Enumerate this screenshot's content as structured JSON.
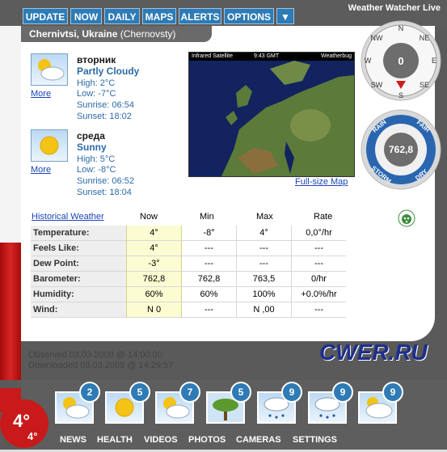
{
  "app_title": "Weather Watcher Live",
  "toolbar": {
    "buttons": [
      "UPDATE",
      "NOW",
      "DAILY",
      "MAPS",
      "ALERTS",
      "OPTIONS"
    ],
    "dropdown_icon": "chevron-down-icon"
  },
  "location": {
    "name": "Chernivtsi, Ukraine",
    "alt": "(Chernovsty)"
  },
  "forecast": [
    {
      "day": "вторник",
      "condition": "Partly Cloudy",
      "high": "High: 2°C",
      "low": "Low: -7°C",
      "sunrise": "Sunrise: 06:54",
      "sunset": "Sunset: 18:02",
      "more": "More",
      "icon": "partly-cloudy-icon"
    },
    {
      "day": "среда",
      "condition": "Sunny",
      "high": "High: 5°C",
      "low": "Low: -8°C",
      "sunrise": "Sunrise: 06:52",
      "sunset": "Sunset: 18:04",
      "more": "More",
      "icon": "sunny-icon"
    }
  ],
  "map": {
    "label_left": "Infrared Satellite",
    "label_mid": "9:43 GMT",
    "label_right": "Weatherbug",
    "link": "Full-size Map"
  },
  "compass": {
    "value": "0",
    "directions": [
      "N",
      "NE",
      "E",
      "SE",
      "S",
      "SW",
      "W",
      "NW"
    ]
  },
  "barometer": {
    "value": "762,8",
    "labels": [
      "RAIN",
      "FAIR",
      "DRY",
      "STORM"
    ]
  },
  "table": {
    "link": "Historical Weather",
    "headers": [
      "Now",
      "Min",
      "Max",
      "Rate"
    ],
    "rows": [
      {
        "label": "Temperature:",
        "now": "4°",
        "min": "-8°",
        "max": "4°",
        "rate": "0,0°/hr"
      },
      {
        "label": "Feels Like:",
        "now": "4°",
        "min": "---",
        "max": "---",
        "rate": "---"
      },
      {
        "label": "Dew Point:",
        "now": "-3°",
        "min": "---",
        "max": "---",
        "rate": "---"
      },
      {
        "label": "Barometer:",
        "now": "762,8",
        "min": "762,8",
        "max": "763,5",
        "rate": "0/hr"
      },
      {
        "label": "Humidity:",
        "now": "60%",
        "min": "60%",
        "max": "100%",
        "rate": "+0.0%/hr"
      },
      {
        "label": "Wind:",
        "now": "N 0",
        "min": "---",
        "max": "N ,00",
        "rate": "---"
      }
    ]
  },
  "status": {
    "observed": "Observed 03.03.2009 @ 14:00:00",
    "downloaded": "Downloaded 03.03.2009 @ 14:29:57"
  },
  "watermark": "CWER.RU",
  "current_temp": {
    "big": "4°",
    "small": "4°"
  },
  "tiles": [
    {
      "icon": "partly-cloudy-icon",
      "count": "2"
    },
    {
      "icon": "sunny-icon",
      "count": "5"
    },
    {
      "icon": "partly-cloudy-icon",
      "count": "7"
    },
    {
      "icon": "tree-icon",
      "count": "5"
    },
    {
      "icon": "rain-icon",
      "count": "9"
    },
    {
      "icon": "rain-icon",
      "count": "9"
    },
    {
      "icon": "cloudy-icon",
      "count": "9"
    }
  ],
  "nav": [
    "NEWS",
    "HEALTH",
    "VIDEOS",
    "PHOTOS",
    "CAMERAS",
    "SETTINGS"
  ],
  "colors": {
    "accent": "#2e7bb5",
    "red": "#c81a1a",
    "link": "#1b45b8"
  }
}
